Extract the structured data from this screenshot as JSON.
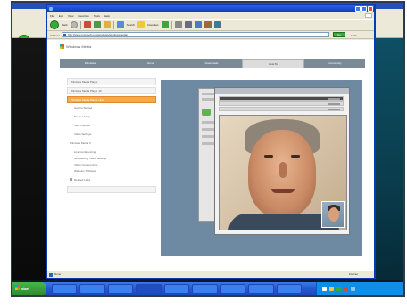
{
  "outer_browser": {
    "back_label": "Back"
  },
  "window": {
    "title": "",
    "menu": [
      "File",
      "Edit",
      "View",
      "Favorites",
      "Tools",
      "Help"
    ]
  },
  "toolbar": {
    "back_label": "Back",
    "search_label": "Search",
    "favorites_label": "Favorites"
  },
  "address": {
    "label": "Address",
    "url": "http://www.microsoft.com/windows/windowsmedia/",
    "go_label": "Go",
    "links_label": "Links"
  },
  "page": {
    "brand": "Windows Media",
    "nav_tabs": [
      "Windows",
      "Home",
      "Downloads",
      "How To",
      "Community"
    ],
    "active_tab_index": 3,
    "sidebar": {
      "top_items": [
        "Windows Media Player",
        "Windows Media Player 10",
        "Windows Media Player Help"
      ],
      "active_item_index": 2,
      "sub_items": [
        "Getting Started",
        "Media Library",
        "Skin Chooser",
        "Video Settings",
        "Windows Media 9"
      ],
      "detail_items": [
        "Live Conferencing",
        "Net Meeting Video Settings",
        "Video Conferencing",
        "Webcam Software"
      ],
      "footer_item": "Related Links",
      "search_placeholder": ""
    }
  },
  "statusbar": {
    "text": "Done",
    "zone": "Internet"
  },
  "taskbar": {
    "start_label": "start",
    "buttons": [
      "",
      "",
      "",
      "",
      "",
      "",
      "",
      "",
      ""
    ],
    "clock": ""
  },
  "colors": {
    "titlebar": "#0a3ab8",
    "active_sidebar": "#f4a94a",
    "navbar": "#7a8a96",
    "taskbar": "#2458d0"
  }
}
